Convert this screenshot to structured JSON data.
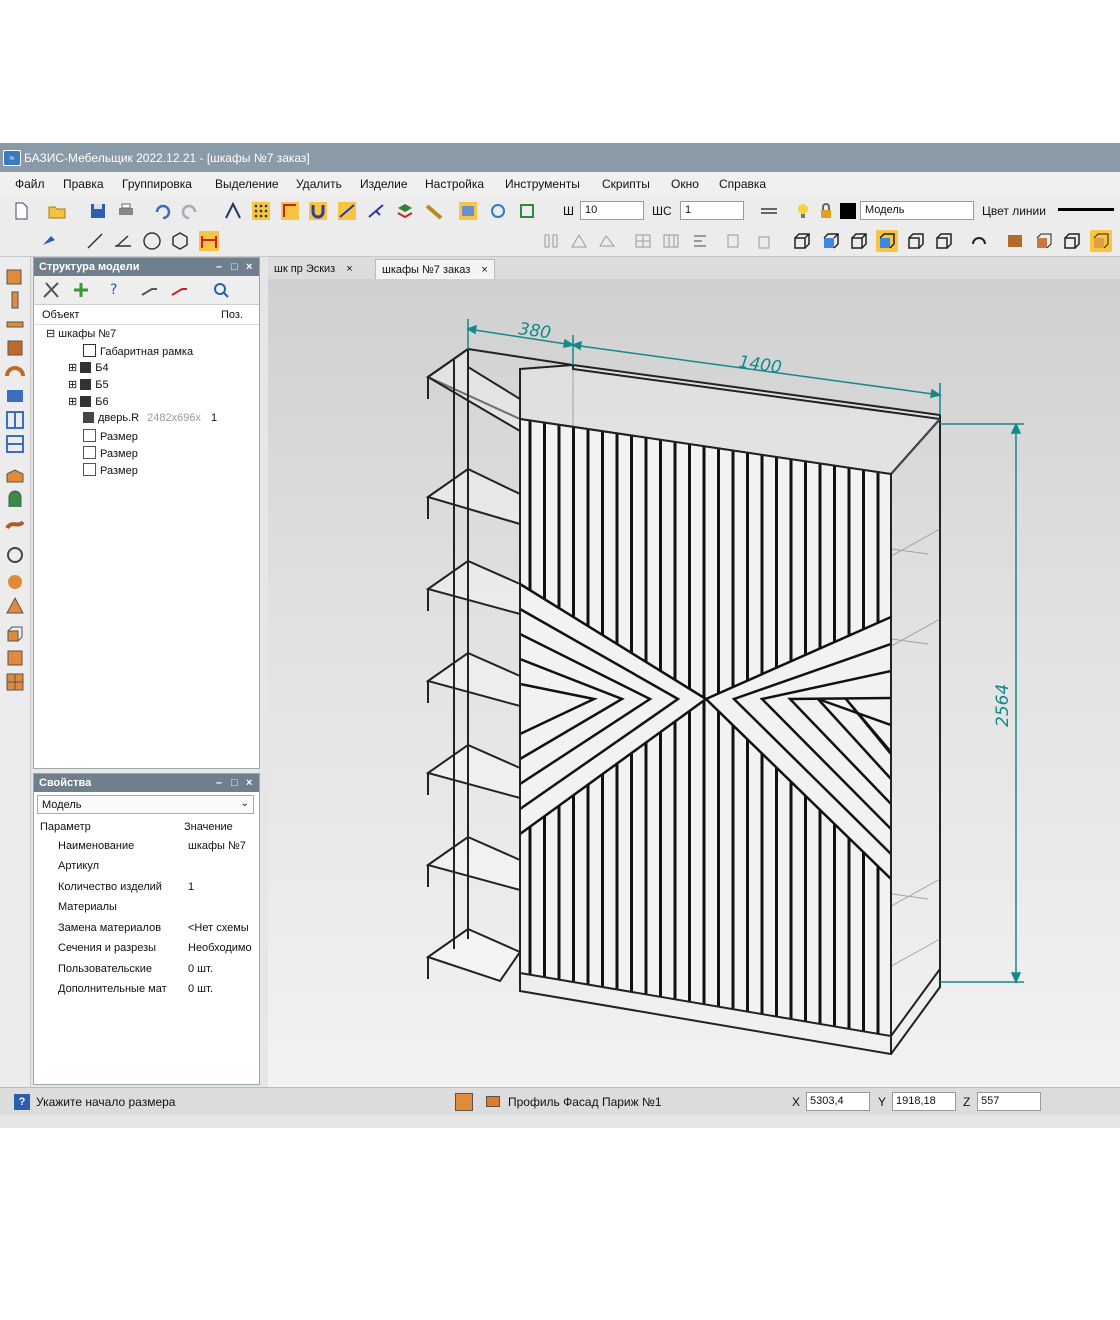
{
  "window": {
    "title": "БАЗИС-Мебельщик 2022.12.21 - [шкафы №7 заказ]"
  },
  "menu": [
    "Файл",
    "Правка",
    "Группировка",
    "Выделение",
    "Удалить",
    "Изделие",
    "Настройка",
    "Инструменты",
    "Скрипты",
    "Окно",
    "Справка"
  ],
  "toolbar": {
    "width_label": "Ш",
    "width_value": "10",
    "ws_label": "ШС",
    "ws_value": "1",
    "layer_value": "Модель",
    "line_color_label": "Цвет линии"
  },
  "model_panel": {
    "title": "Структура модели",
    "col_object": "Объект",
    "col_pos": "Поз.",
    "root": "шкафы №7",
    "items": [
      {
        "label": "Габаритная рамка",
        "size": "",
        "pos": ""
      },
      {
        "label": "Б4",
        "size": "",
        "pos": ""
      },
      {
        "label": "Б5",
        "size": "",
        "pos": ""
      },
      {
        "label": "Б6",
        "size": "",
        "pos": ""
      },
      {
        "label": "дверь.R",
        "size": "2482x696x",
        "pos": "1"
      },
      {
        "label": "Размер",
        "size": "",
        "pos": ""
      },
      {
        "label": "Размер",
        "size": "",
        "pos": ""
      },
      {
        "label": "Размер",
        "size": "",
        "pos": ""
      }
    ]
  },
  "props_panel": {
    "title": "Свойства",
    "selector": "Модель",
    "col_param": "Параметр",
    "col_value": "Значение",
    "rows": [
      {
        "param": "Наименование",
        "value": "шкафы №7"
      },
      {
        "param": "Артикул",
        "value": ""
      },
      {
        "param": "Количество изделий",
        "value": "1"
      },
      {
        "param": "Материалы",
        "value": ""
      },
      {
        "param": "Замена материалов",
        "value": "<Нет схемы"
      },
      {
        "param": "Сечения и разрезы",
        "value": "Необходимо"
      },
      {
        "param": "Пользовательские",
        "value": "0 шт."
      },
      {
        "param": "Дополнительные мат",
        "value": "0 шт."
      }
    ]
  },
  "tabs": [
    {
      "label": "шк пр Эскиз",
      "active": false
    },
    {
      "label": "шкафы №7 заказ",
      "active": true
    }
  ],
  "drawing": {
    "dim_depth": "380",
    "dim_width": "1400",
    "dim_height": "2564"
  },
  "status": {
    "prompt": "Укажите начало размера",
    "material": "Профиль Фасад Париж №1",
    "x_label": "X",
    "x": "5303,4",
    "y_label": "Y",
    "y": "1918,18",
    "z_label": "Z",
    "z": "557"
  }
}
